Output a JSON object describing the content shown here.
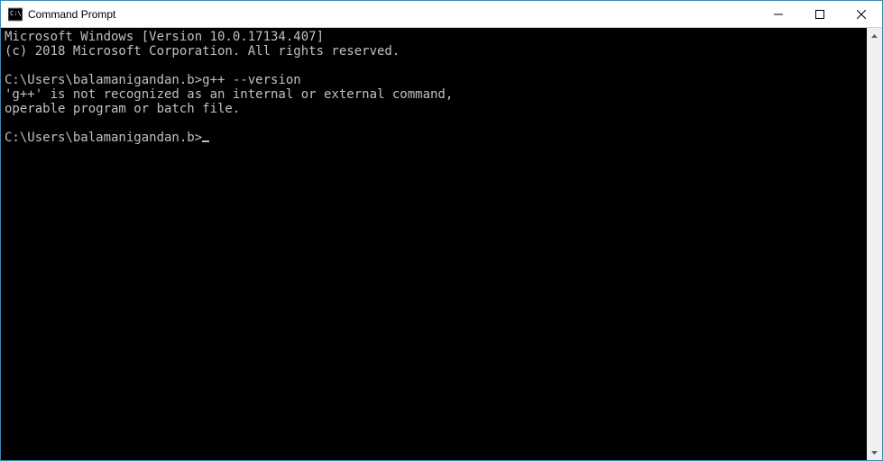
{
  "window": {
    "title": "Command Prompt"
  },
  "terminal": {
    "line1": "Microsoft Windows [Version 10.0.17134.407]",
    "line2": "(c) 2018 Microsoft Corporation. All rights reserved.",
    "blank1": "",
    "prompt1_path": "C:\\Users\\balamanigandan.b>",
    "prompt1_cmd": "g++ --version",
    "error1": "'g++' is not recognized as an internal or external command,",
    "error2": "operable program or batch file.",
    "blank2": "",
    "prompt2_path": "C:\\Users\\balamanigandan.b>"
  }
}
